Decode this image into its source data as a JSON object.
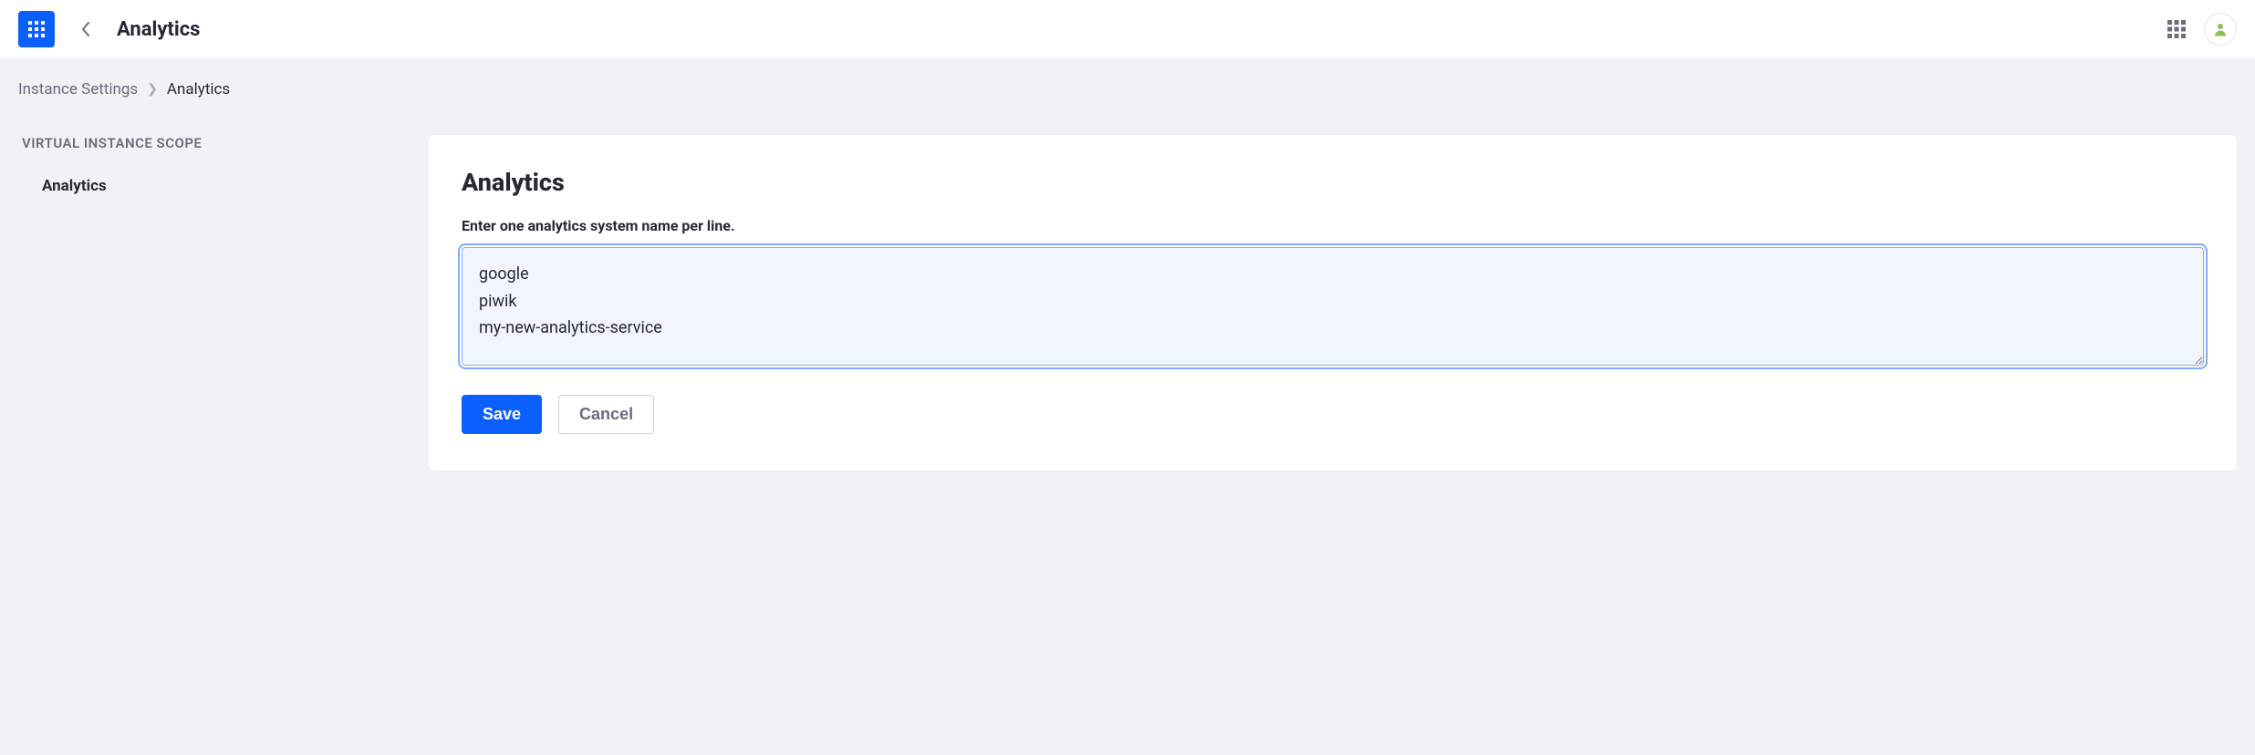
{
  "header": {
    "title": "Analytics"
  },
  "breadcrumbs": {
    "parent": "Instance Settings",
    "current": "Analytics"
  },
  "sidebar": {
    "heading": "VIRTUAL INSTANCE SCOPE",
    "items": [
      {
        "label": "Analytics"
      }
    ]
  },
  "card": {
    "title": "Analytics",
    "field_label": "Enter one analytics system name per line.",
    "textarea_value": "google\npiwik\nmy-new-analytics-service"
  },
  "buttons": {
    "save": "Save",
    "cancel": "Cancel"
  }
}
